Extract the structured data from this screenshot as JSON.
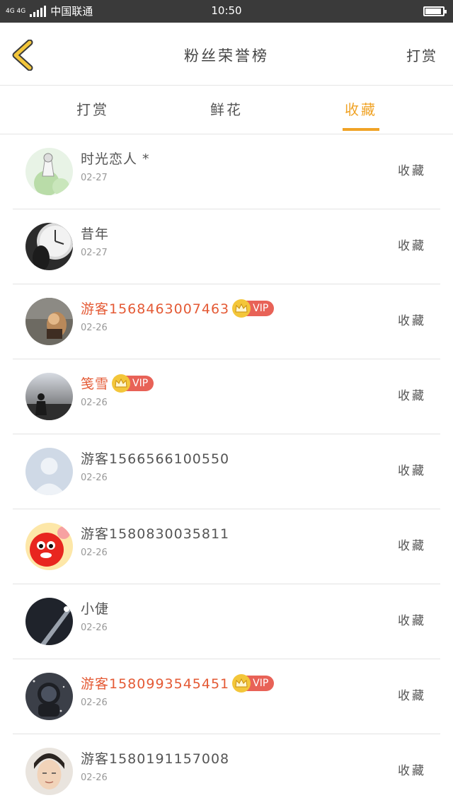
{
  "status_bar": {
    "network": "4G 4G",
    "carrier": "中国联通",
    "time": "10:50",
    "battery_level": 0.85
  },
  "header": {
    "title": "粉丝荣誉榜",
    "right_action": "打赏",
    "back_icon": "chevron-left-icon"
  },
  "tabs": [
    {
      "label": "打赏",
      "active": false
    },
    {
      "label": "鲜花",
      "active": false
    },
    {
      "label": "收藏",
      "active": true
    }
  ],
  "accent_color": "#f0a326",
  "vip_color": "#e86257",
  "list": [
    {
      "name": "时光恋人 *",
      "date": "02-27",
      "vip": false,
      "action": "收藏",
      "avatar": "anime-girl-avatar"
    },
    {
      "name": "昔年",
      "date": "02-27",
      "vip": false,
      "action": "收藏",
      "avatar": "clock-avatar"
    },
    {
      "name": "游客1568463007463",
      "date": "02-26",
      "vip": true,
      "vip_label": "VIP",
      "action": "收藏",
      "avatar": "photo-avatar"
    },
    {
      "name": "笺雪",
      "date": "02-26",
      "vip": true,
      "vip_label": "VIP",
      "action": "收藏",
      "avatar": "silhouette-avatar"
    },
    {
      "name": "游客1566566100550",
      "date": "02-26",
      "vip": false,
      "action": "收藏",
      "avatar": "default-avatar"
    },
    {
      "name": "游客1580830035811",
      "date": "02-26",
      "vip": false,
      "action": "收藏",
      "avatar": "qq-penguin-avatar"
    },
    {
      "name": "小倢",
      "date": "02-26",
      "vip": false,
      "action": "收藏",
      "avatar": "dark-avatar"
    },
    {
      "name": "游客1580993545451",
      "date": "02-26",
      "vip": true,
      "vip_label": "VIP",
      "action": "收藏",
      "avatar": "astronaut-avatar"
    },
    {
      "name": "游客1580191157008",
      "date": "02-26",
      "vip": false,
      "action": "收藏",
      "avatar": "boy-avatar"
    }
  ]
}
